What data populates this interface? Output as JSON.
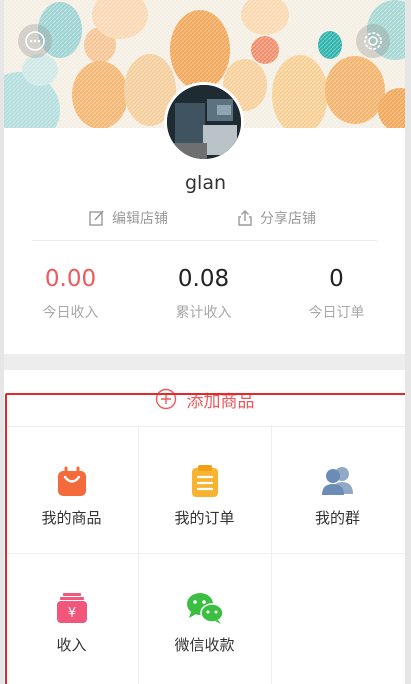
{
  "header": {
    "message_icon": "chat-bubble-icon",
    "settings_icon": "gear-icon"
  },
  "profile": {
    "username": "glan"
  },
  "actions": {
    "edit_label": "编辑店铺",
    "share_label": "分享店铺"
  },
  "stats": [
    {
      "value": "0.00",
      "label": "今日收入"
    },
    {
      "value": "0.08",
      "label": "累计收入"
    },
    {
      "value": "0",
      "label": "今日订单"
    }
  ],
  "add_product": {
    "label": "添加商品"
  },
  "menu": [
    {
      "label": "我的商品",
      "icon": "shopping-bag-icon"
    },
    {
      "label": "我的订单",
      "icon": "clipboard-list-icon"
    },
    {
      "label": "我的群",
      "icon": "group-users-icon"
    },
    {
      "label": "收入",
      "icon": "wallet-yen-icon"
    },
    {
      "label": "微信收款",
      "icon": "wechat-icon"
    }
  ],
  "colors": {
    "accent_red": "#f0595b",
    "highlight_frame": "#e8272a",
    "bag_orange": "#f56a3a",
    "order_yellow": "#f8b431",
    "group_blue": "#6b8db5",
    "income_pink": "#f0577a",
    "wechat_green": "#3cbe43"
  }
}
